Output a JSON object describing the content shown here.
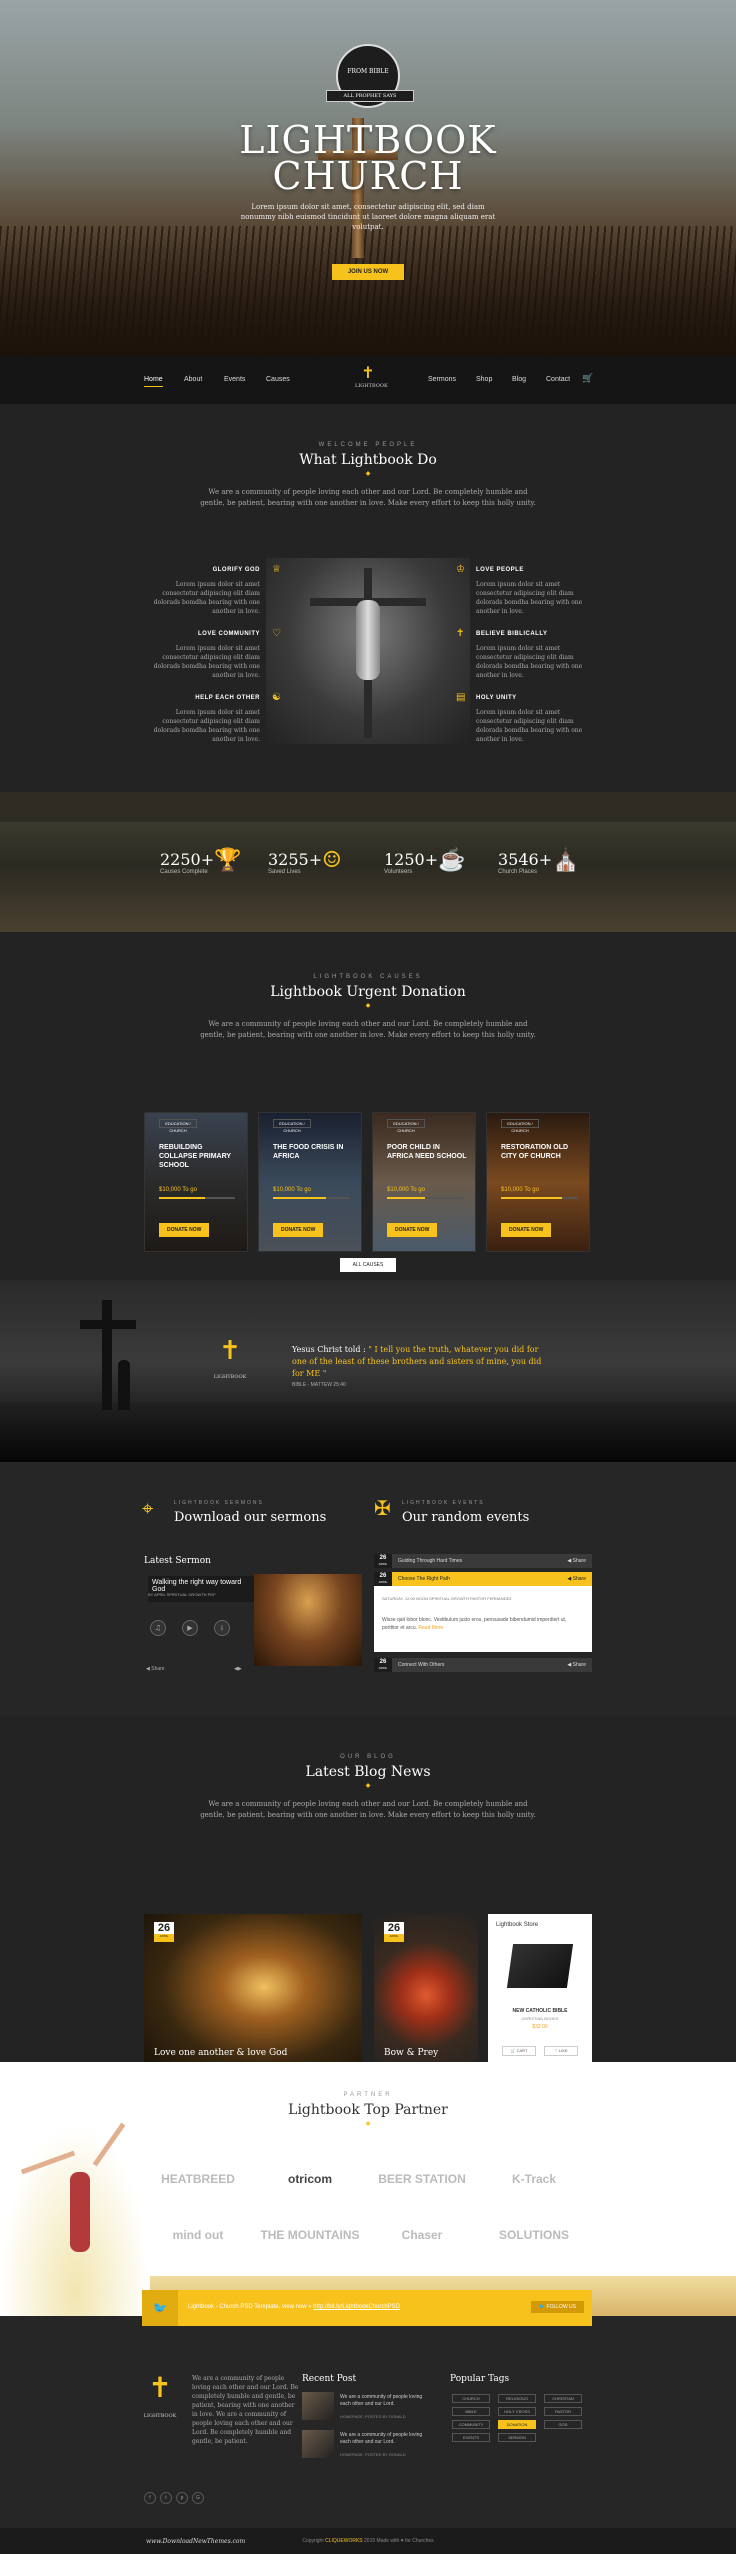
{
  "hero": {
    "badge_top": "FROM BIBLE",
    "badge_ribbon": "ALL PROPHET SAYS",
    "title_line1": "LIGHTBOOK",
    "title_line2": "CHURCH",
    "text": "Lorem ipsum dolor sit amet, consectetur adipiscing elit, sed diam nonummy nibh euismod tincidunt ut laoreet dolore magna aliquam erat volutpat.",
    "button": "JOIN US NOW"
  },
  "nav": {
    "left": [
      "Home",
      "About",
      "Events",
      "Causes"
    ],
    "logo": "LIGHTBOOK",
    "right": [
      "Sermons",
      "Shop",
      "Blog",
      "Contact"
    ]
  },
  "what": {
    "kicker": "WELCOME PEOPLE",
    "title": "What Lightbook Do",
    "intro": "We are a community of people loving each other and our Lord. Be completely humble and gentle, be patient, bearing with one another in love. Make every effort to keep this holly unity.",
    "features_left": [
      {
        "title": "GLORIFY GOD",
        "text": "Lorem ipsum dolor sit amet consectetur adipiscing elit diam dolorads bomdha bearing with one another in love."
      },
      {
        "title": "LOVE COMMUNITY",
        "text": "Lorem ipsum dolor sit amet consectetur adipiscing elit diam dolorads bomdha bearing with one another in love."
      },
      {
        "title": "HELP EACH OTHER",
        "text": "Lorem ipsum dolor sit amet consectetur adipiscing elit diam dolorads bomdha bearing with one another in love."
      }
    ],
    "features_right": [
      {
        "title": "LOVE PEOPLE",
        "text": "Lorem ipsum dolor sit amet consectetur adipiscing elit diam dolorads bomdha bearing with one another in love."
      },
      {
        "title": "BELIEVE BIBLICALLY",
        "text": "Lorem ipsum dolor sit amet consectetur adipiscing elit diam dolorads bomdha bearing with one another in love."
      },
      {
        "title": "HOLY UNITY",
        "text": "Lorem ipsum dolor sit amet consectetur adipiscing elit diam dolorads bomdha bearing with one another in love."
      }
    ]
  },
  "stats": [
    {
      "value": "2250+",
      "label": "Causes Complete",
      "icon": "trophy-icon"
    },
    {
      "value": "3255+",
      "label": "Saved Lives",
      "icon": "people-icon"
    },
    {
      "value": "1250+",
      "label": "Volunteers",
      "icon": "cup-icon"
    },
    {
      "value": "3546+",
      "label": "Church Places",
      "icon": "church-icon"
    }
  ],
  "causes": {
    "kicker": "LIGHTBOOK CAUSES",
    "title": "Lightbook Urgent Donation",
    "intro": "We are a community of people loving each other and our Lord. Be completely humble and gentle, be patient, bearing with one another in love. Make every effort to keep this holly unity.",
    "items": [
      {
        "tag": "EDUCATION / CHURCH",
        "title": "REBUILDING COLLAPSE PRIMARY SCHOOL",
        "raised": "$10,000 To go",
        "progress": 0.6,
        "button": "DONATE NOW"
      },
      {
        "tag": "EDUCATION / CHURCH",
        "title": "THE FOOD CRISIS IN AFRICA",
        "raised": "$10,000 To go",
        "progress": 0.7,
        "button": "DONATE NOW"
      },
      {
        "tag": "EDUCATION / CHURCH",
        "title": "POOR CHILD IN AFRICA NEED SCHOOL",
        "raised": "$10,000 To go",
        "progress": 0.5,
        "button": "DONATE NOW"
      },
      {
        "tag": "EDUCATION / CHURCH",
        "title": "RESTORATION OLD CITY OF CHURCH",
        "raised": "$10,000 To go",
        "progress": 0.8,
        "button": "DONATE NOW"
      }
    ],
    "all_button": "ALL CAUSES"
  },
  "quote": {
    "logo": "LIGHTBOOK",
    "speaker": "Yesus Christ told :",
    "text": "\" I tell you the truth, whatever you did for one of the least of these brothers and sisters of mine, you did for ME \"",
    "source": "BIBLE - MATTEW 25:40"
  },
  "sermons": {
    "kicker": "LIGHTBOOK SERMONS",
    "title": "Download our sermons",
    "label": "Latest Sermon",
    "sermon_title": "Walking the right way toward God",
    "meta": "BY APRIL   SPIRITUAL GROWTH   PDF",
    "share": "Share"
  },
  "events": {
    "kicker": "LIGHTBOOK EVENTS",
    "title": "Our random events",
    "items": [
      {
        "day": "26",
        "month": "APRIL",
        "title": "Guiding Through Hard Times",
        "share": "Share",
        "active": false
      },
      {
        "day": "26",
        "month": "APRIL",
        "title": "Choose The Right Path",
        "share": "Share",
        "active": true
      },
      {
        "day": "26",
        "month": "APRIL",
        "title": "Connect With Others",
        "share": "Share",
        "active": false
      }
    ],
    "meta": "SATURDAY, 12:00 NOON   SPIRITUAL GROWTH   PASTOR FERNANDEZ",
    "body": "Wisse qait lobor blonc. Vestibulum justo eros, pensusade bibendumid imperdiert ut, porttitor et arcu.",
    "read_more": "Read More"
  },
  "blog": {
    "kicker": "OUR BLOG",
    "title": "Latest Blog News",
    "intro": "We are a community of people loving each other and our Lord. Be completely humble and gentle, be patient, bearing with one another in love. Make every effort to keep this holly unity.",
    "posts": [
      {
        "day": "26",
        "month": "APRIL",
        "title": "Love one another & love God",
        "meta": "HOMEPAGE   SPIRITUAL GROWTH   PASTOR"
      },
      {
        "day": "26",
        "month": "APRIL",
        "title": "Bow & Prey",
        "meta": "SPIRITUAL GROWTH   PASTOR"
      }
    ],
    "store": {
      "heading": "Lightbook Store",
      "book": "NEW CATHOLIC BIBLE",
      "category": "CHRISTIAN BOOKS",
      "price": "$32.00",
      "cart": "CART",
      "like": "LIKE"
    }
  },
  "partners": {
    "kicker": "PARTNER",
    "title": "Lightbook Top Partner",
    "logos": [
      "HEATBREED",
      "otricom",
      "BEER STATION",
      "K-Track",
      "mind out",
      "THE MOUNTAINS",
      "Chaser",
      "SOLUTIONS"
    ]
  },
  "twitter": {
    "text": "Lightbook - Church PSD Template, view now »",
    "link": "http://bit.ly/LightbookChurchPSD",
    "follow": "FOLLOW US"
  },
  "footer": {
    "logo": "LIGHTBOOK",
    "about": "We are a community of people loving each other and our Lord. Be completely humble and gentle, be patient, bearing with one another in love. We are a community of people loving each other and our Lord. Be completely humble and gentle, be patient.",
    "recent_title": "Recent Post",
    "posts": [
      {
        "text": "We are a community of people loving each other and our Lord.",
        "meta": "HOMEPAGE, POSTED BY DONALD"
      },
      {
        "text": "We are a community of people loving each other and our Lord.",
        "meta": "HOMEPAGE, POSTED BY DONALD"
      }
    ],
    "tags_title": "Popular Tags",
    "tags": [
      "CHURCH",
      "RELIGIOUS",
      "CHRISTIAN",
      "BIBLE",
      "HOLY CROSS",
      "PASTOR",
      "COMMUNITY",
      "DONATION",
      "GOD",
      "EVENTS",
      "SERMON"
    ],
    "social": [
      "f",
      "t",
      "p",
      "G"
    ],
    "watermark": "www.DownloadNewThemes.com",
    "copyright_pre": "Copyright",
    "copyright_brand": "CLIQUEWORKS",
    "copyright_post": "2015 Made with ♥ for Churches"
  },
  "accent_color": "#f7c21b"
}
